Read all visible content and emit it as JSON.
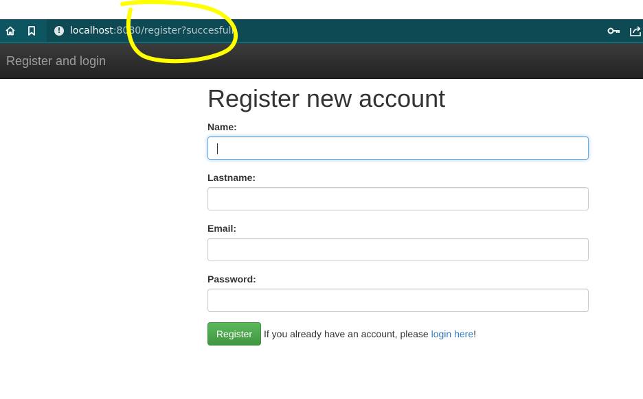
{
  "browser": {
    "url_host": "localhost",
    "url_rest": ":8080/register?succesfull"
  },
  "navbar": {
    "brand": "Register and login"
  },
  "form": {
    "title": "Register new account",
    "fields": [
      {
        "label": "Name:",
        "value": ""
      },
      {
        "label": "Lastname:",
        "value": ""
      },
      {
        "label": "Email:",
        "value": ""
      },
      {
        "label": "Password:",
        "value": ""
      }
    ],
    "submit_label": "Register",
    "hint_prefix": "If you already have an account, please ",
    "hint_link": "login here",
    "hint_suffix": "!"
  },
  "icons": {
    "home": "home-icon",
    "bookmark": "bookmark-icon",
    "info": "info-icon",
    "key": "key-icon",
    "share": "share-icon"
  },
  "colors": {
    "browser_bar": "#0d5560",
    "navbar": "#222222",
    "highlight": "#ffff00",
    "button": "#5cb85c",
    "link": "#337ab7"
  }
}
